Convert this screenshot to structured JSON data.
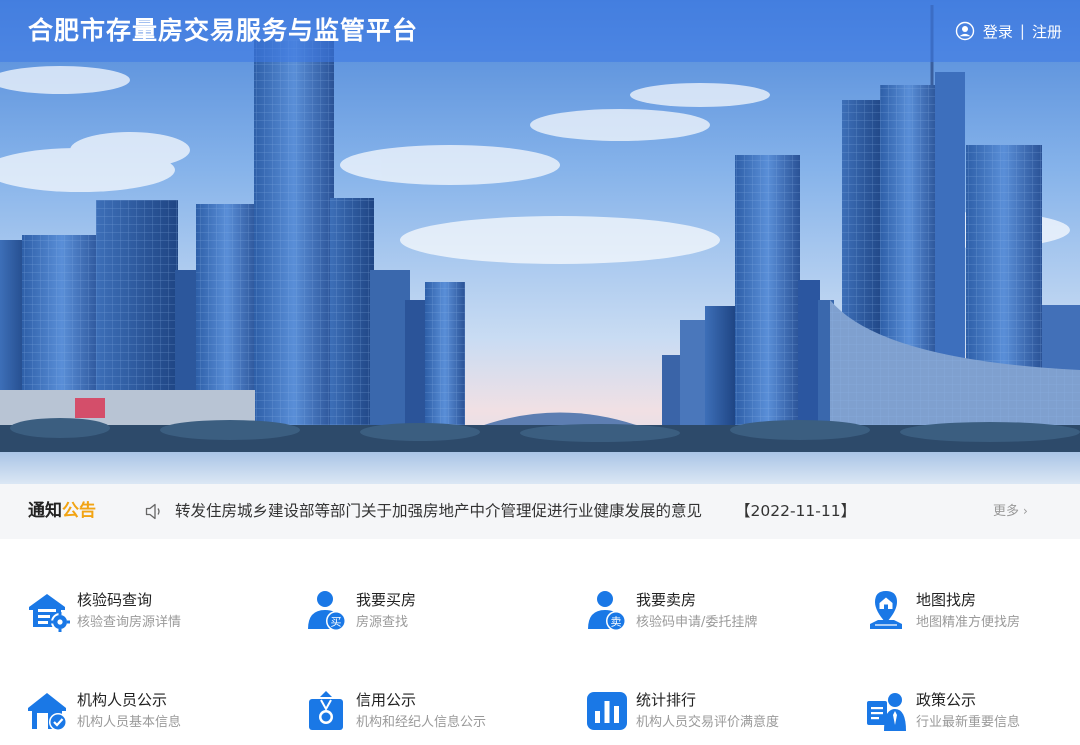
{
  "header": {
    "site_title": "合肥市存量房交易服务与监管平台",
    "login_label": "登录",
    "separator": "|",
    "register_label": "注册"
  },
  "notice": {
    "title_part1": "通知",
    "title_part2": "公告",
    "text": "转发住房城乡建设部等部门关于加强房地产中介管理促进行业健康发展的意见",
    "date": "【2022-11-11】",
    "more_label": "更多",
    "more_icon": "chevron-right-icon"
  },
  "services": [
    {
      "title": "核验码查询",
      "desc": "核验查询房源详情",
      "icon": "house-gear-icon"
    },
    {
      "title": "我要买房",
      "desc": "房源查找",
      "icon": "user-buy-icon",
      "badge": "买"
    },
    {
      "title": "我要卖房",
      "desc": "核验码申请/委托挂牌",
      "icon": "user-sell-icon",
      "badge": "卖"
    },
    {
      "title": "地图找房",
      "desc": "地图精准方便找房",
      "icon": "map-pin-icon"
    },
    {
      "title": "机构人员公示",
      "desc": "机构人员基本信息",
      "icon": "house-check-icon"
    },
    {
      "title": "信用公示",
      "desc": "机构和经纪人信息公示",
      "icon": "credit-medal-icon"
    },
    {
      "title": "统计排行",
      "desc": "机构人员交易评价满意度",
      "icon": "bar-chart-icon"
    },
    {
      "title": "政策公示",
      "desc": "行业最新重要信息",
      "icon": "policy-person-icon"
    }
  ],
  "colors": {
    "primary_blue": "#1a78e6",
    "accent_orange": "#f2a414",
    "header_overlay": "#3c78e6"
  }
}
